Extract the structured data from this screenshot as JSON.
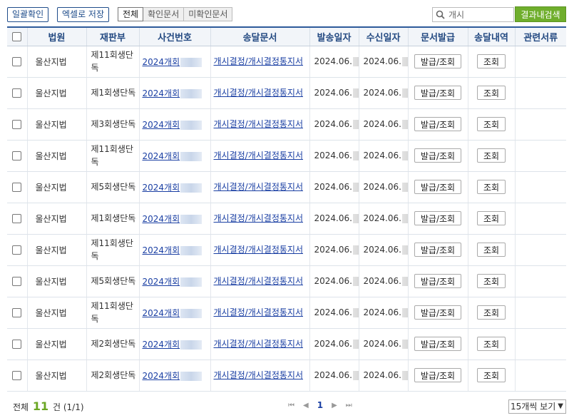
{
  "toolbar": {
    "bulk_confirm_label": "일괄확인",
    "excel_save_label": "엑셀로 저장",
    "filters": [
      "전체",
      "확인문서",
      "미확인문서"
    ],
    "active_filter": 0,
    "search_value": "개시",
    "search_button_label": "결과내검색"
  },
  "table": {
    "headers": [
      "법원",
      "재판부",
      "사건번호",
      "송달문서",
      "발송일자",
      "수신일자",
      "문서발급",
      "송달내역",
      "관련서류"
    ],
    "issue_button_label": "발급/조회",
    "history_button_label": "조회",
    "rows": [
      {
        "court": "울산지법",
        "division": "제11회생단독",
        "case_no": "2024개회",
        "document": "개시결정/개시결정통지서",
        "sent_date": "2024.06.",
        "recv_date": "2024.06."
      },
      {
        "court": "울산지법",
        "division": "제1회생단독",
        "case_no": "2024개회",
        "document": "개시결정/개시결정통지서",
        "sent_date": "2024.06.",
        "recv_date": "2024.06."
      },
      {
        "court": "울산지법",
        "division": "제3회생단독",
        "case_no": "2024개회",
        "document": "개시결정/개시결정통지서",
        "sent_date": "2024.06.",
        "recv_date": "2024.06."
      },
      {
        "court": "울산지법",
        "division": "제11회생단독",
        "case_no": "2024개회",
        "document": "개시결정/개시결정통지서",
        "sent_date": "2024.06.",
        "recv_date": "2024.06."
      },
      {
        "court": "울산지법",
        "division": "제5회생단독",
        "case_no": "2024개회",
        "document": "개시결정/개시결정통지서",
        "sent_date": "2024.06.",
        "recv_date": "2024.06."
      },
      {
        "court": "울산지법",
        "division": "제1회생단독",
        "case_no": "2024개회",
        "document": "개시결정/개시결정통지서",
        "sent_date": "2024.06.",
        "recv_date": "2024.06."
      },
      {
        "court": "울산지법",
        "division": "제11회생단독",
        "case_no": "2024개회",
        "document": "개시결정/개시결정통지서",
        "sent_date": "2024.06.",
        "recv_date": "2024.06."
      },
      {
        "court": "울산지법",
        "division": "제5회생단독",
        "case_no": "2024개회",
        "document": "개시결정/개시결정통지서",
        "sent_date": "2024.06.",
        "recv_date": "2024.06."
      },
      {
        "court": "울산지법",
        "division": "제11회생단독",
        "case_no": "2024개회",
        "document": "개시결정/개시결정통지서",
        "sent_date": "2024.06.",
        "recv_date": "2024.06."
      },
      {
        "court": "울산지법",
        "division": "제2회생단독",
        "case_no": "2024개회",
        "document": "개시결정/개시결정통지서",
        "sent_date": "2024.06.",
        "recv_date": "2024.06."
      },
      {
        "court": "울산지법",
        "division": "제2회생단독",
        "case_no": "2024개회",
        "document": "개시결정/개시결정통지서",
        "sent_date": "2024.06.",
        "recv_date": "2024.06."
      }
    ]
  },
  "footer": {
    "total_prefix": "전체",
    "total_count": "11",
    "total_suffix": "건 (1/1)",
    "current_page": "1",
    "page_size_label": "15개씩 보기"
  },
  "colors": {
    "accent": "#2d5a9a",
    "search_button": "#6fae2c",
    "count": "#6aa623",
    "link": "#1a3fa3"
  }
}
